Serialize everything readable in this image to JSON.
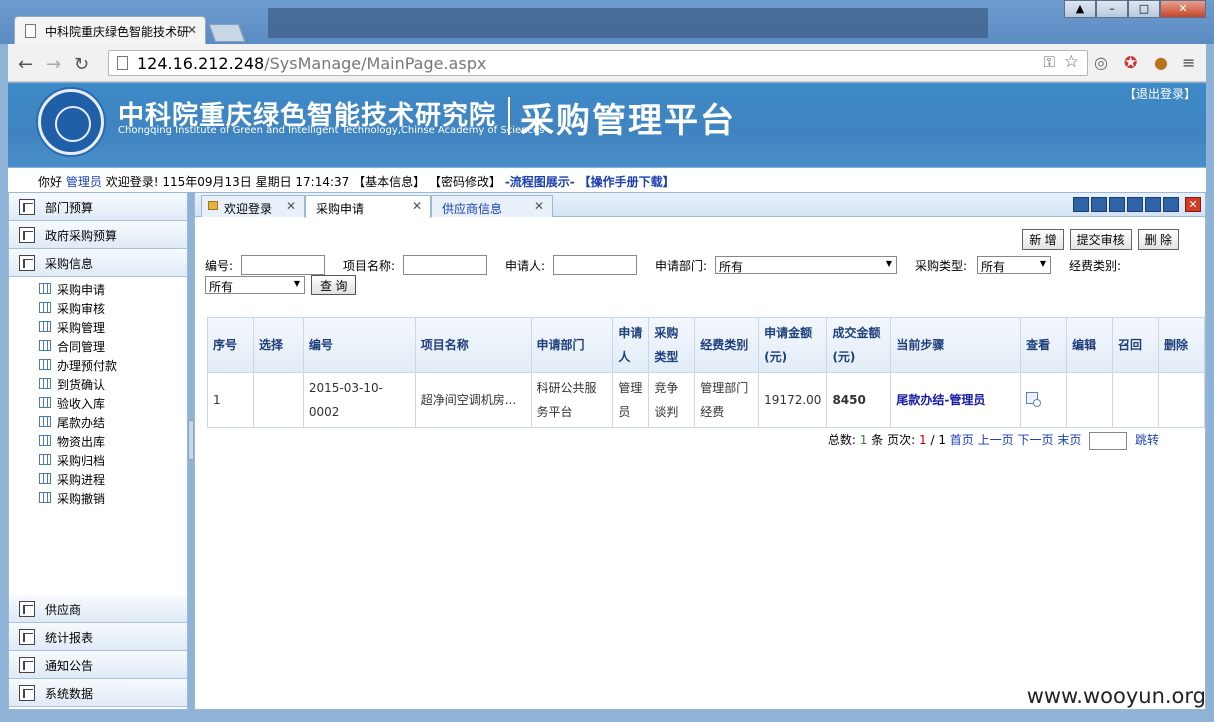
{
  "browser": {
    "tab_title": "中科院重庆绿色智能技术研",
    "url_host": "124.16.212.248",
    "url_path": "/SysManage/MainPage.aspx"
  },
  "banner": {
    "org_cn": "中科院重庆绿色智能技术研究院",
    "org_en": "Chongqing Institute of Green and Intelligent Technology,Chinse Academy of Sciences",
    "system_title": "采购管理平台",
    "logout": "【退出登录】"
  },
  "infobar": {
    "greeting": "你好",
    "user": "管理员",
    "welcome": "欢迎登录!",
    "datetime": "115年09月13日 星期日 17:14:37",
    "basic_info": "【基本信息】",
    "pwd_change": "【密码修改】",
    "flow_chart": "-流程图展示-",
    "manual": "【操作手册下载】"
  },
  "sidebar": {
    "top_menus": [
      "部门预算",
      "政府采购预算",
      "采购信息"
    ],
    "sub_items": [
      "采购申请",
      "采购审核",
      "采购管理",
      "合同管理",
      "办理预付款",
      "到货确认",
      "验收入库",
      "尾款办结",
      "物资出库",
      "采购归档",
      "采购进程",
      "采购撤销"
    ],
    "bottom_menus": [
      "供应商",
      "统计报表",
      "通知公告",
      "系统数据"
    ]
  },
  "tabs": [
    {
      "label": "欢迎登录"
    },
    {
      "label": "采购申请"
    },
    {
      "label": "供应商信息"
    }
  ],
  "actions": {
    "new": "新 增",
    "submit": "提交审核",
    "delete": "删 除"
  },
  "filters": {
    "code_label": "编号:",
    "project_label": "项目名称:",
    "applicant_label": "申请人:",
    "dept_label": "申请部门:",
    "dept_value": "所有",
    "type_label": "采购类型:",
    "type_value": "所有",
    "fund_label": "经费类别:",
    "fund_value": "所有",
    "query": "查 询"
  },
  "table": {
    "headers": [
      "序号",
      "选择",
      "编号",
      "项目名称",
      "申请部门",
      "申请人",
      "采购类型",
      "经费类别",
      "申请金额(元)",
      "成交金额(元)",
      "当前步骤",
      "查看",
      "编辑",
      "召回",
      "删除"
    ],
    "rows": [
      {
        "seq": "1",
        "code": "2015-03-10-0002",
        "project": "超净间空调机房...",
        "dept": "科研公共服务平台",
        "applicant": "管理员",
        "ptype": "竞争谈判",
        "fund": "管理部门经费",
        "apply_amt": "19172.00",
        "deal_amt": "8450",
        "step": "尾款办结-管理员"
      }
    ]
  },
  "pager": {
    "total_label": "总数:",
    "total": "1",
    "unit": "条",
    "page_label": "页次:",
    "current": "1",
    "sep": "/",
    "pages": "1",
    "first": "首页",
    "prev": "上一页",
    "next": "下一页",
    "last": "末页",
    "jump": "跳转"
  },
  "watermark": "www.wooyun.org"
}
